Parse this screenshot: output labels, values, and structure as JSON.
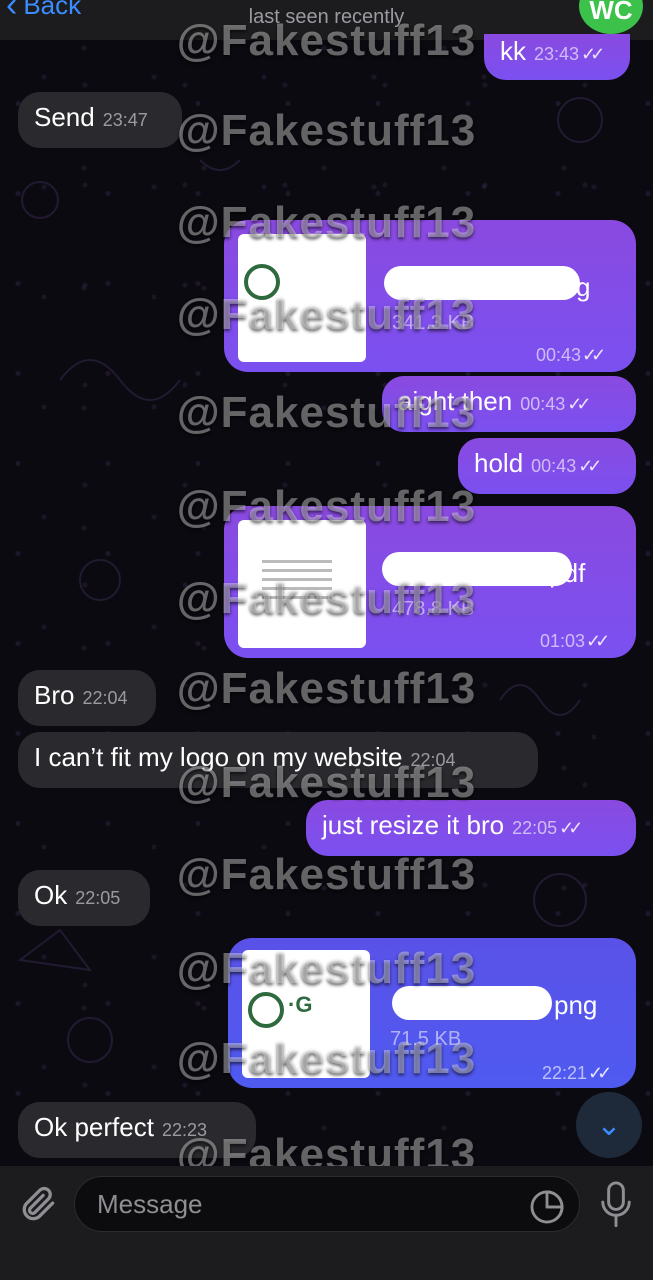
{
  "header": {
    "back_label": "Back",
    "subtitle": "last seen recently",
    "avatar_initials": "WC"
  },
  "watermark": "@Fakestuff13",
  "messages": [
    {
      "dir": "out",
      "text": "kk",
      "time": "23:43"
    },
    {
      "dir": "in",
      "text": "Send",
      "time": "23:47"
    },
    {
      "dir": "out",
      "type": "file",
      "name_tail": "g",
      "size": "341.3 KB",
      "time": "00:43"
    },
    {
      "dir": "out",
      "text": "aight then",
      "time": "00:43"
    },
    {
      "dir": "out",
      "text": "hold",
      "time": "00:43"
    },
    {
      "dir": "out",
      "type": "file",
      "name_tail": ".pdf",
      "size": "478.8 KB",
      "time": "01:03"
    },
    {
      "dir": "in",
      "text": "Bro",
      "time": "22:04"
    },
    {
      "dir": "in",
      "text": "I can’t fit my logo on my website",
      "time": "22:04"
    },
    {
      "dir": "out",
      "text": "just resize it bro",
      "time": "22:05"
    },
    {
      "dir": "in",
      "text": "Ok",
      "time": "22:05"
    },
    {
      "dir": "out",
      "type": "file",
      "name_tail": "png",
      "size": "71.5 KB",
      "time": "22:21"
    },
    {
      "dir": "in",
      "text": "Ok perfect",
      "time": "22:23"
    }
  ],
  "composer": {
    "placeholder": "Message"
  },
  "colors": {
    "outgoing": "#8a4ae0",
    "incoming": "#2a2a2e",
    "accent": "#3a8cff",
    "avatar": "#3cc24a"
  },
  "icons": [
    "chevron-left-icon",
    "double-check-icon",
    "paperclip-icon",
    "sticker-icon",
    "microphone-icon",
    "chevron-down-icon"
  ]
}
